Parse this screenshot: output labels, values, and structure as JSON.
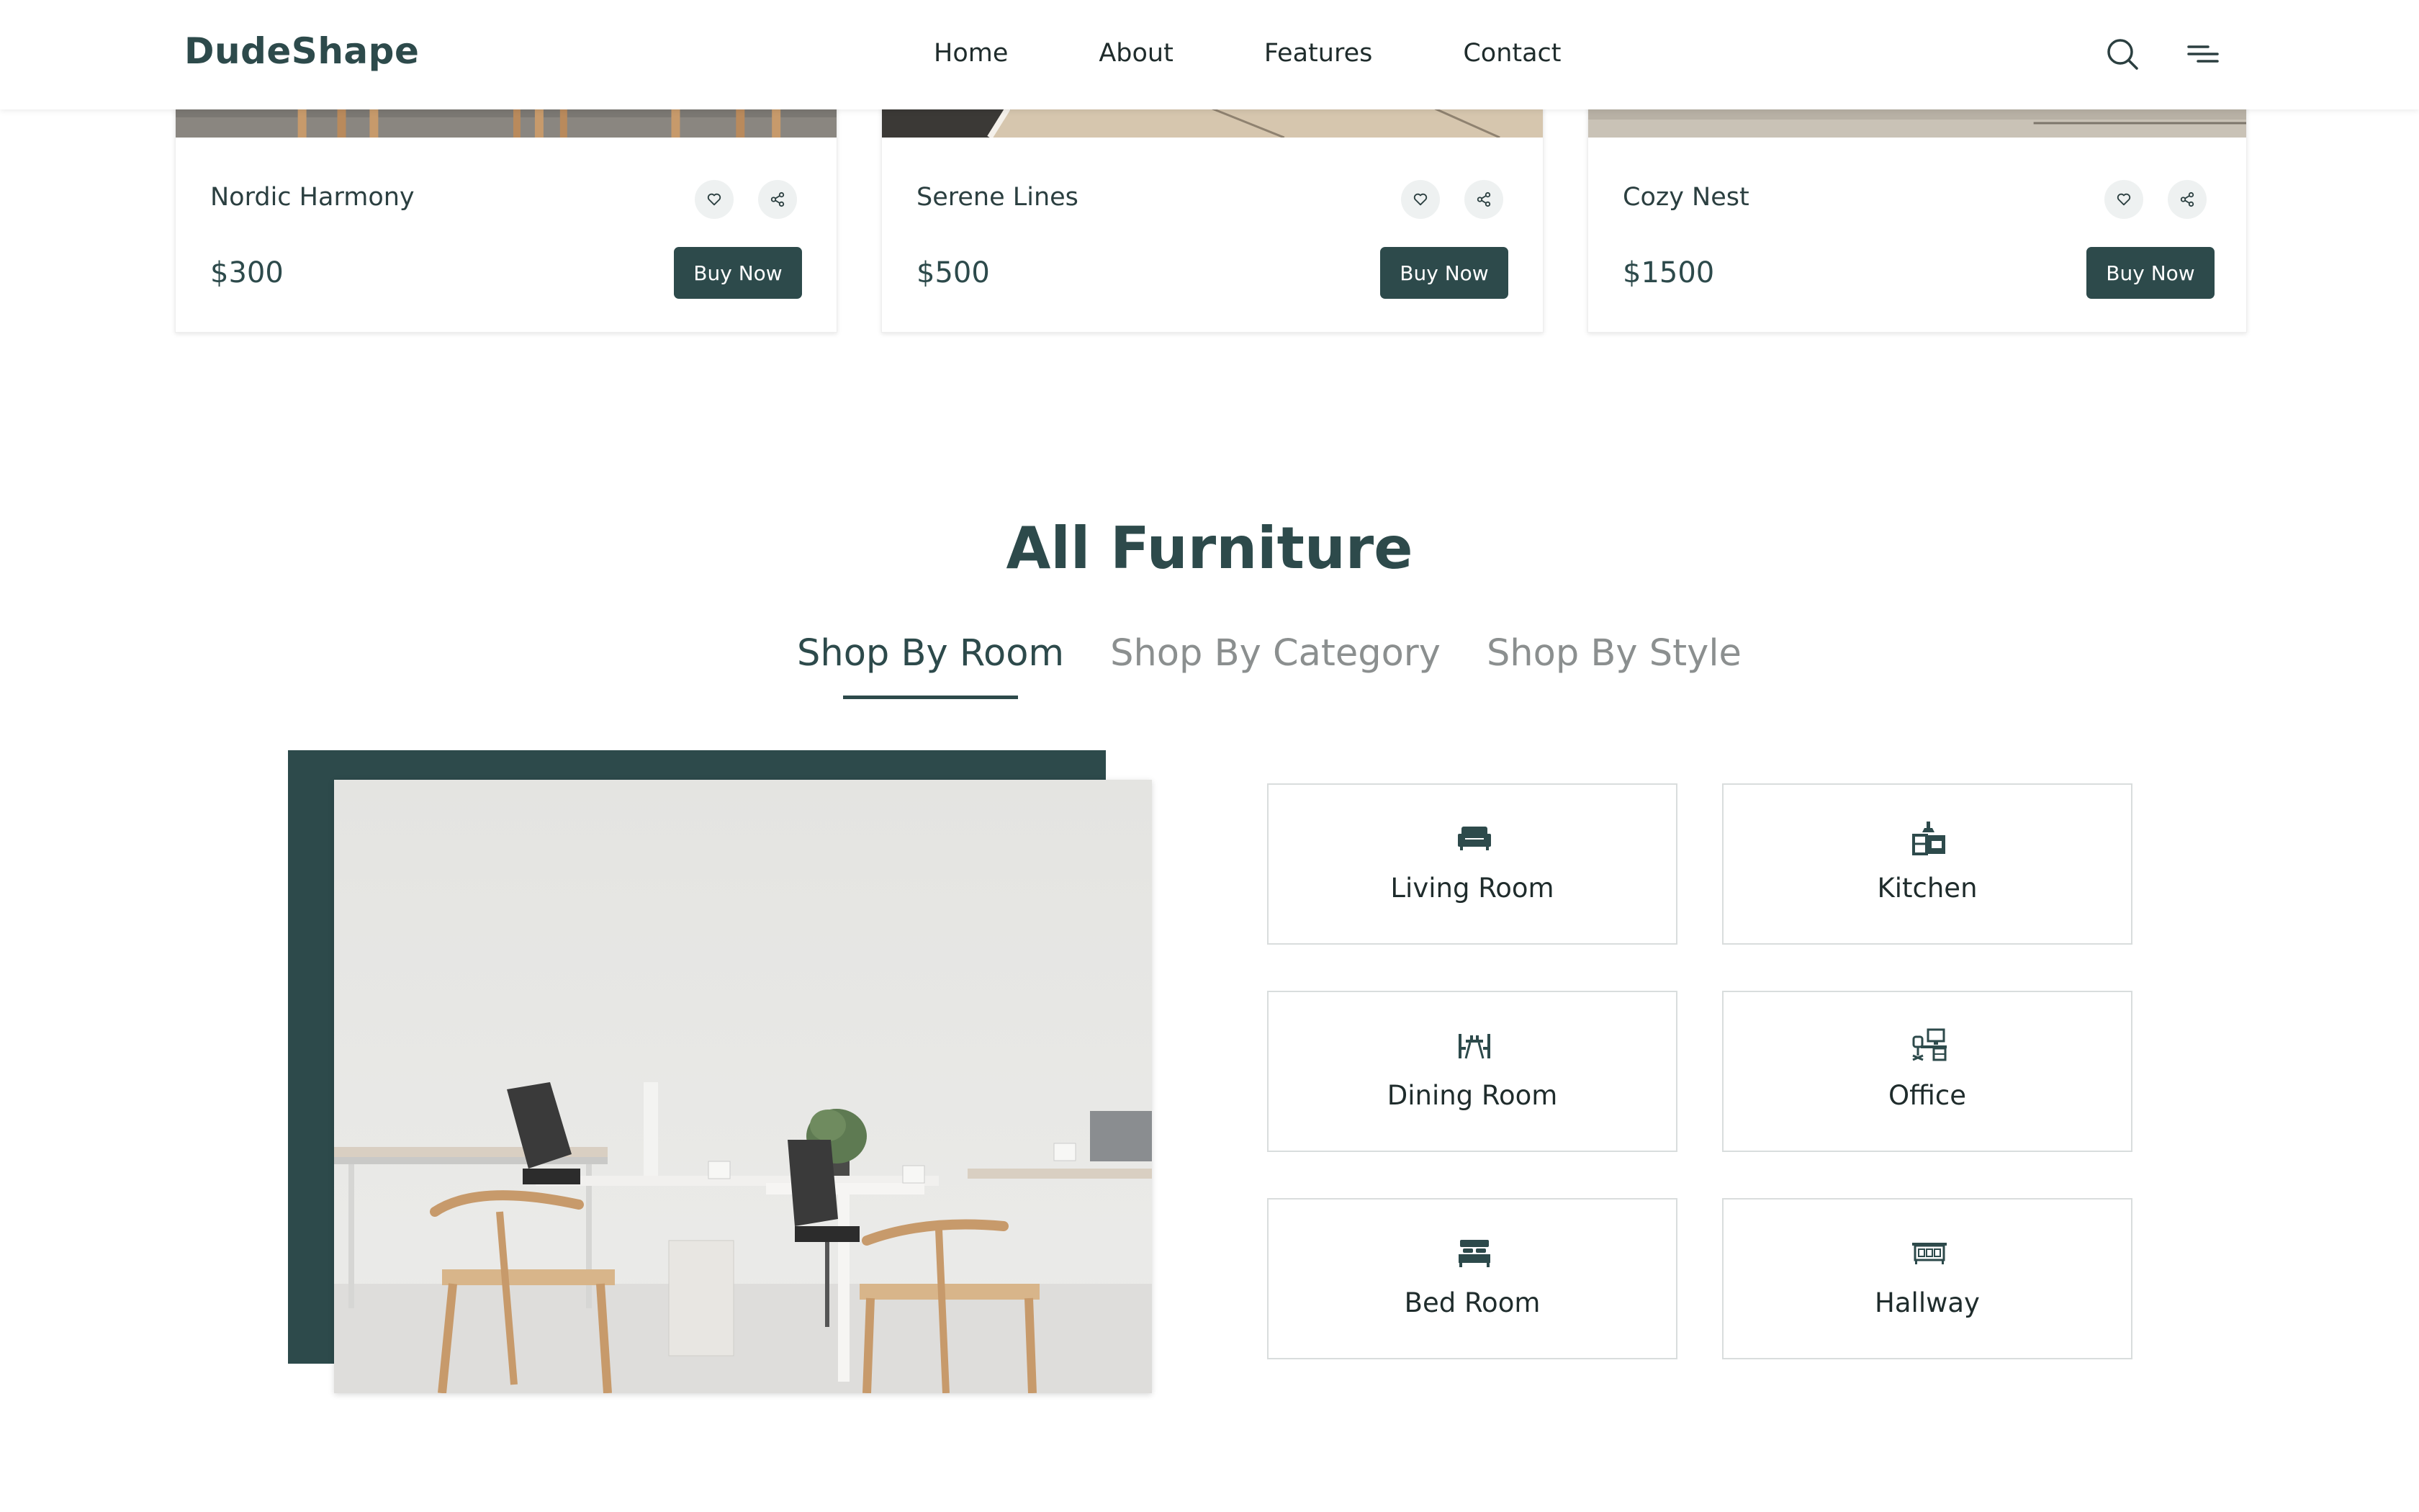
{
  "header": {
    "logo": "DudeShape",
    "nav": [
      "Home",
      "About",
      "Features",
      "Contact"
    ],
    "icons": [
      "search-icon",
      "menu-icon"
    ]
  },
  "products": [
    {
      "name": "Nordic Harmony",
      "price": "$300",
      "button": "Buy Now"
    },
    {
      "name": "Serene Lines",
      "price": "$500",
      "button": "Buy Now"
    },
    {
      "name": "Cozy Nest",
      "price": "$1500",
      "button": "Buy Now"
    }
  ],
  "section": {
    "title": "All Furniture",
    "tabs": [
      "Shop By Room",
      "Shop By Category",
      "Shop By Style"
    ],
    "active_tab": "Shop By Room"
  },
  "rooms": [
    {
      "label": "Living Room",
      "icon": "sofa-icon"
    },
    {
      "label": "Kitchen",
      "icon": "kitchen-icon"
    },
    {
      "label": "Dining Room",
      "icon": "dining-table-icon"
    },
    {
      "label": "Office",
      "icon": "office-desk-icon"
    },
    {
      "label": "Bed Room",
      "icon": "bed-icon"
    },
    {
      "label": "Hallway",
      "icon": "hallway-cabinet-icon"
    }
  ],
  "colors": {
    "brand": "#2d4a4b",
    "text": "#1f2c2c",
    "muted": "#8b8f8f",
    "border": "#d9dddd"
  }
}
